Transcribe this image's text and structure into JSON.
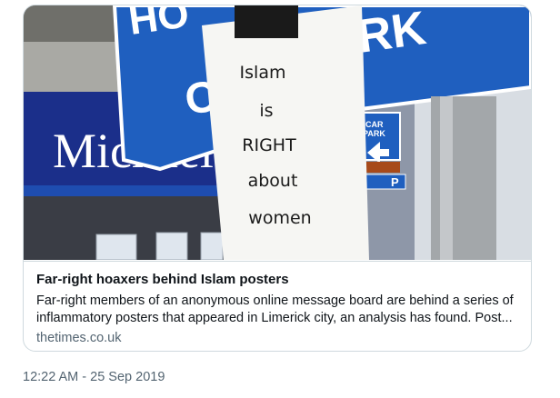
{
  "card": {
    "image_alt": "Poster reading Islam is RIGHT about women taped to a sign pole",
    "poster_lines": [
      "Islam",
      "is",
      "RIGHT",
      "about",
      "women"
    ],
    "sign_text": {
      "shop_name": "Michael Rob",
      "car_park_top": "CAR",
      "car_park_bottom": "PARK",
      "parking_letter": "P"
    },
    "headline": "Far-right hoaxers behind Islam posters",
    "description": "Far-right members of an anonymous online message board are behind a series of inflammatory posters that appeared in Limerick city, an analysis has found. Post...",
    "domain": "thetimes.co.uk"
  },
  "tweet": {
    "timestamp": "12:22 AM - 25 Sep 2019"
  },
  "colors": {
    "border": "#cfd9de",
    "text_primary": "#0f1419",
    "text_secondary": "#536471",
    "sign_blue": "#1f5fbf",
    "shop_blue": "#1b2f8a"
  }
}
